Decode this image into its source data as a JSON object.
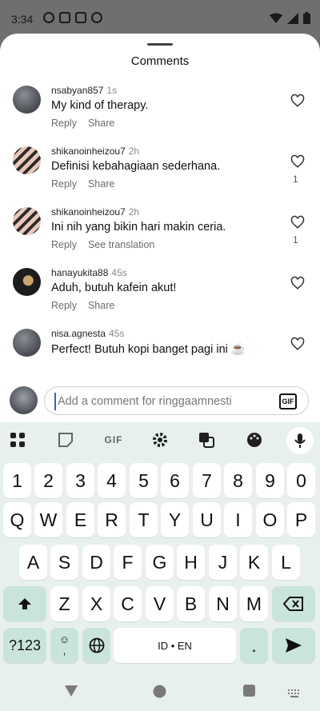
{
  "status_bar": {
    "time": "3:34"
  },
  "sheet": {
    "title": "Comments"
  },
  "comments": [
    {
      "username": "nsabyan857",
      "time": "1s",
      "text": "My kind of therapy.",
      "action1": "Reply",
      "action2": "Share",
      "likes": ""
    },
    {
      "username": "shikanoinheizou7",
      "time": "2h",
      "text": "Definisi kebahagiaan sederhana.",
      "action1": "Reply",
      "action2": "Share",
      "likes": "1"
    },
    {
      "username": "shikanoinheizou7",
      "time": "2h",
      "text": "Ini nih yang bikin hari makin ceria.",
      "action1": "Reply",
      "action2": "See translation",
      "likes": "1"
    },
    {
      "username": "hanayukita88",
      "time": "45s",
      "text": "Aduh, butuh kafein akut!",
      "action1": "Reply",
      "action2": "Share",
      "likes": ""
    },
    {
      "username": "nisa.agnesta",
      "time": "45s",
      "text": "Perfect! Butuh kopi banget pagi ini ☕",
      "action1": "",
      "action2": "",
      "likes": ""
    }
  ],
  "reactions": [
    "❤️",
    "🙌",
    "🔥",
    "👏",
    "😢",
    "😍",
    "😮",
    "😂"
  ],
  "comment_input": {
    "placeholder": "Add a comment for ringgaamnesti",
    "gif_label": "GIF"
  },
  "keyboard": {
    "toolbar": {
      "gif_label": "GIF"
    },
    "row_numbers": [
      "1",
      "2",
      "3",
      "4",
      "5",
      "6",
      "7",
      "8",
      "9",
      "0"
    ],
    "row_q": [
      "Q",
      "W",
      "E",
      "R",
      "T",
      "Y",
      "U",
      "I",
      "O",
      "P"
    ],
    "row_a": [
      "A",
      "S",
      "D",
      "F",
      "G",
      "H",
      "J",
      "K",
      "L"
    ],
    "row_z": [
      "Z",
      "X",
      "C",
      "V",
      "B",
      "N",
      "M"
    ],
    "symbols_label": "?123",
    "emoji_comma": "☺\n,",
    "space_label": "ID • EN",
    "period": "."
  },
  "colors": {
    "accent": "#c9e4dc",
    "keyboard_bg": "#e8f0ed",
    "cursor": "#2f5fe0"
  }
}
